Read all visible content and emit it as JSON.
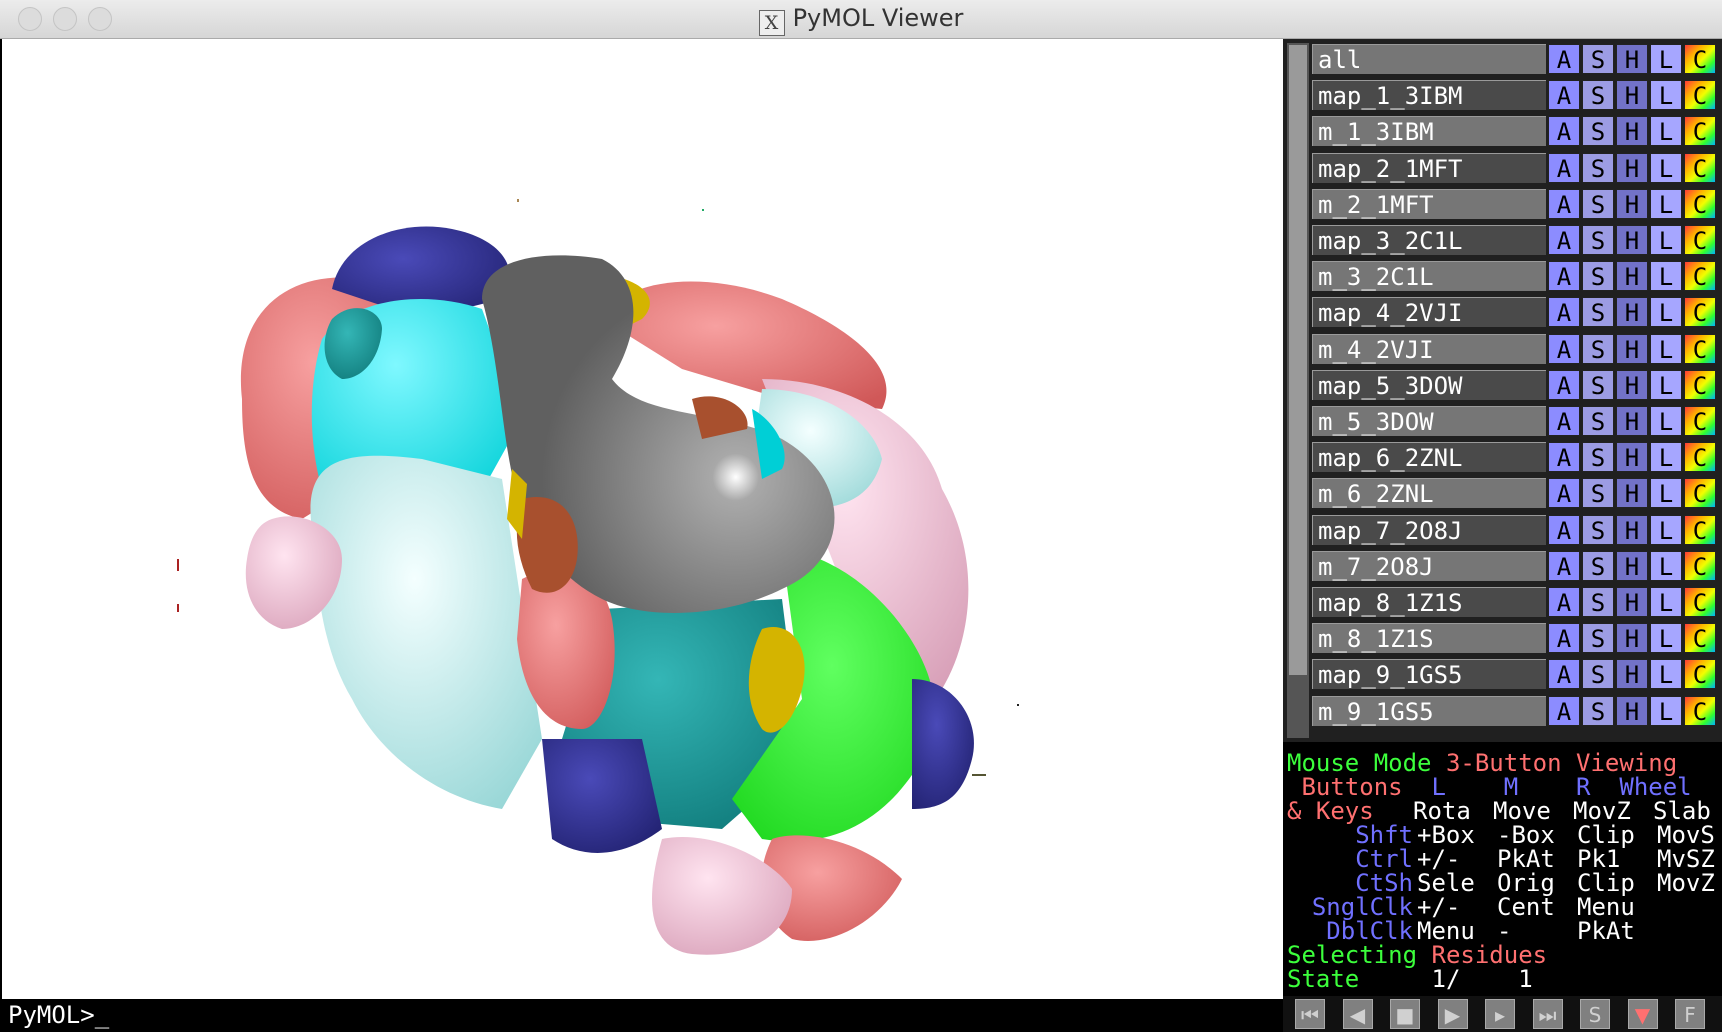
{
  "window": {
    "title": "PyMOL Viewer"
  },
  "objects": [
    {
      "name": "all"
    },
    {
      "name": "map_1_3IBM"
    },
    {
      "name": "m_1_3IBM"
    },
    {
      "name": "map_2_1MFT"
    },
    {
      "name": "m_2_1MFT"
    },
    {
      "name": "map_3_2C1L"
    },
    {
      "name": "m_3_2C1L"
    },
    {
      "name": "map_4_2VJI"
    },
    {
      "name": "m_4_2VJI"
    },
    {
      "name": "map_5_3DOW"
    },
    {
      "name": "m_5_3DOW"
    },
    {
      "name": "map_6_2ZNL"
    },
    {
      "name": "m_6_2ZNL"
    },
    {
      "name": "map_7_2O8J"
    },
    {
      "name": "m_7_2O8J"
    },
    {
      "name": "map_8_1Z1S"
    },
    {
      "name": "m_8_1Z1S"
    },
    {
      "name": "map_9_1GS5"
    },
    {
      "name": "m_9_1GS5"
    }
  ],
  "object_buttons": [
    "A",
    "S",
    "H",
    "L",
    "C"
  ],
  "help": {
    "mouse_mode_label": "Mouse Mode",
    "mouse_mode_value": "3-Button Viewing",
    "buttons_label": "Buttons",
    "col_l": "L",
    "col_m": "M",
    "col_r": "R",
    "col_wheel": "Wheel",
    "keys_label": "& Keys",
    "rows": [
      {
        "mod": "",
        "l": "Rota",
        "m": "Move",
        "r": "MovZ",
        "w": "Slab"
      },
      {
        "mod": "Shft",
        "l": "+Box",
        "m": "-Box",
        "r": "Clip",
        "w": "MovS"
      },
      {
        "mod": "Ctrl",
        "l": "+/-",
        "m": "PkAt",
        "r": "Pk1",
        "w": "MvSZ"
      },
      {
        "mod": "CtSh",
        "l": "Sele",
        "m": "Orig",
        "r": "Clip",
        "w": "MovZ"
      },
      {
        "mod": "SnglClk",
        "l": "+/-",
        "m": "Cent",
        "r": "Menu",
        "w": ""
      },
      {
        "mod": "DblClk",
        "l": "Menu",
        "m": "-",
        "r": "PkAt",
        "w": ""
      }
    ],
    "selecting_label": "Selecting",
    "selecting_value": "Residues",
    "state_label": "State",
    "state_current": "1/",
    "state_total": "1"
  },
  "controls": [
    {
      "label": "⏮",
      "icon": "rewind-icon"
    },
    {
      "label": "◀",
      "icon": "step-back-icon"
    },
    {
      "label": "■",
      "icon": "stop-icon"
    },
    {
      "label": "▶",
      "icon": "play-icon"
    },
    {
      "label": "▸",
      "icon": "step-forward-icon"
    },
    {
      "label": "⏭",
      "icon": "fast-forward-icon"
    },
    {
      "label": "S",
      "icon": "sculpt-icon"
    },
    {
      "label": "▼",
      "icon": "down-icon"
    },
    {
      "label": "F",
      "icon": "fullscreen-icon"
    }
  ],
  "command_prompt": "PyMOL>_"
}
